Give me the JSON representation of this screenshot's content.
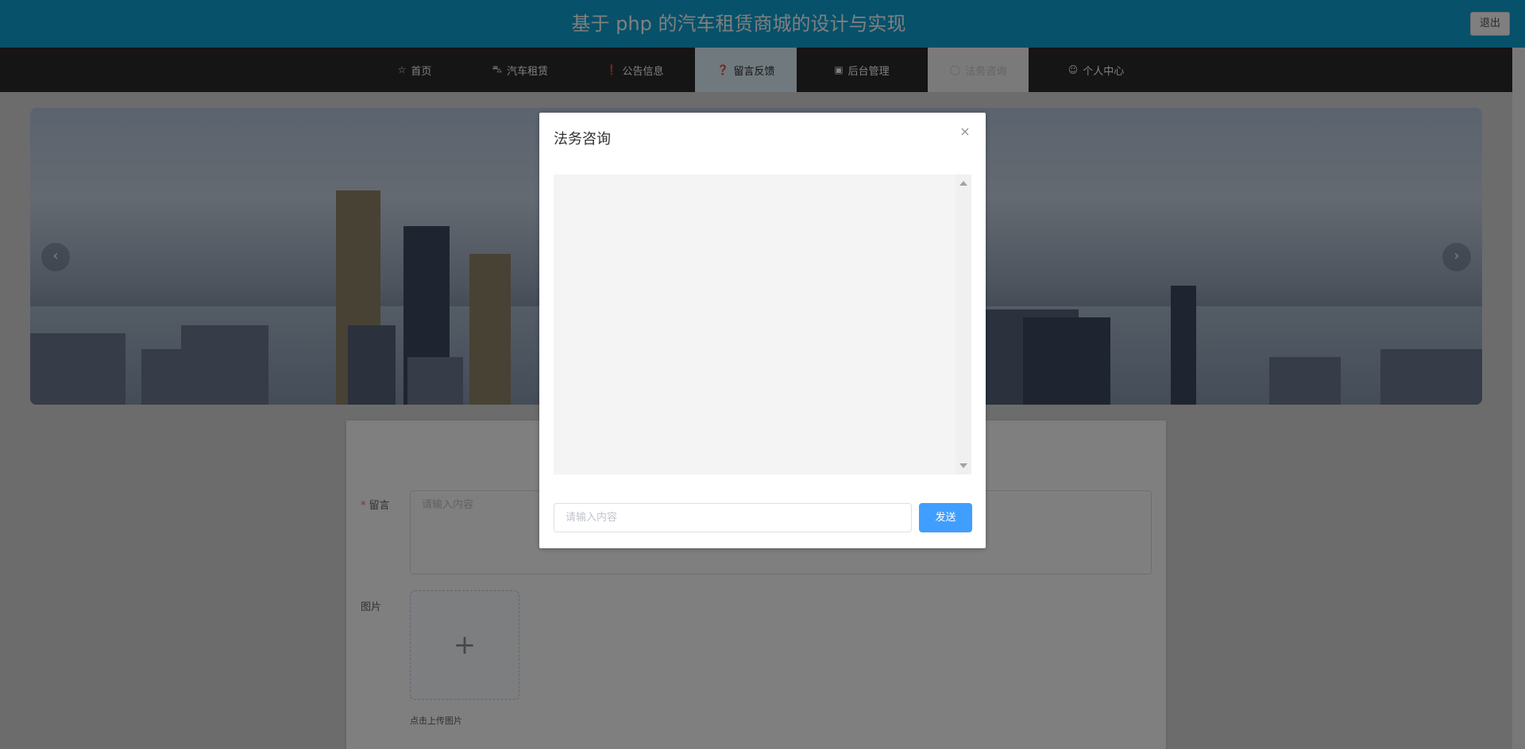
{
  "header": {
    "title": "基于 php 的汽车租赁商城的设计与实现",
    "logout_label": "退出"
  },
  "nav": {
    "items": [
      {
        "label": "首页",
        "icon": "star-icon"
      },
      {
        "label": "汽车租赁",
        "icon": "bag-icon"
      },
      {
        "label": "公告信息",
        "icon": "info-circle-icon"
      },
      {
        "label": "留言反馈",
        "icon": "question-circle-icon",
        "active": true
      },
      {
        "label": "后台管理",
        "icon": "box-icon"
      },
      {
        "label": "法务咨询",
        "icon": "headset-icon",
        "disabled": true
      },
      {
        "label": "个人中心",
        "icon": "user-icon"
      }
    ]
  },
  "carousel": {
    "prev_glyph": "‹",
    "next_glyph": "›"
  },
  "form": {
    "message_label": "留言",
    "message_required_mark": "*",
    "message_placeholder": "请输入内容",
    "image_label": "图片",
    "upload_plus": "+",
    "upload_hint": "点击上传图片"
  },
  "dialog": {
    "title": "法务咨询",
    "close_glyph": "×",
    "input_placeholder": "请输入内容",
    "send_label": "发送"
  },
  "colors": {
    "header_bg": "#0fa3d4",
    "nav_bg": "#2b2b2b",
    "primary": "#409eff"
  }
}
